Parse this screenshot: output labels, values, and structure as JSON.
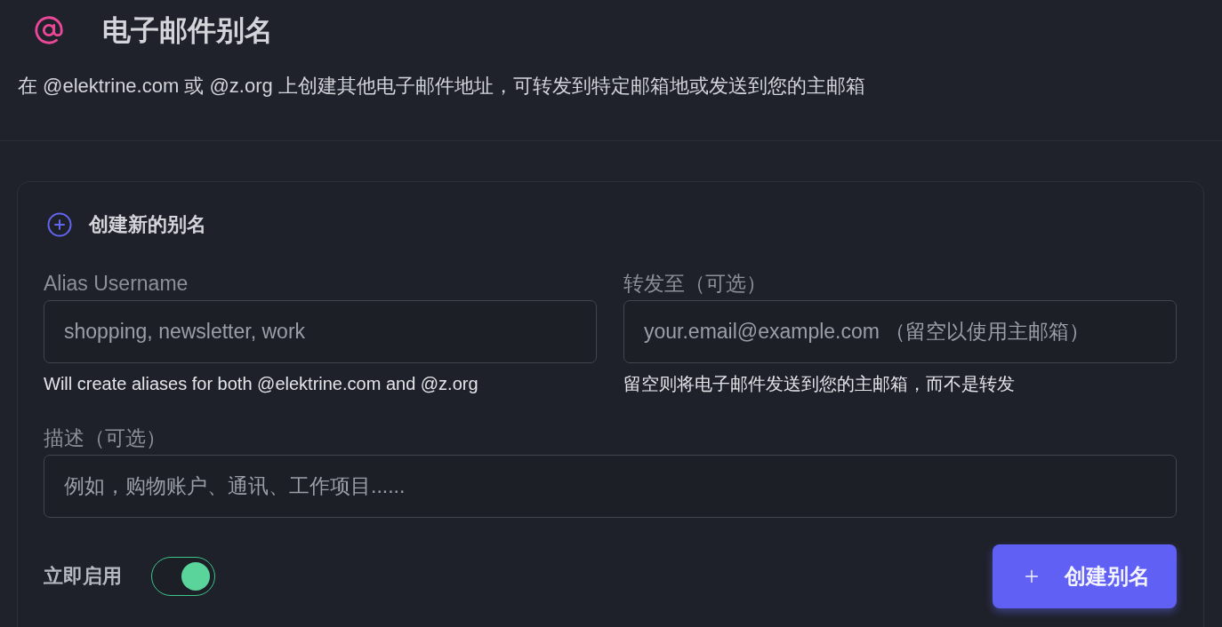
{
  "header": {
    "title": "电子邮件别名",
    "subtitle": "在 @elektrine.com 或 @z.org 上创建其他电子邮件地址，可转发到特定邮箱地或发送到您的主邮箱"
  },
  "form": {
    "heading": "创建新的别名",
    "fields": [
      {
        "label": "Alias Username",
        "placeholder": "shopping, newsletter, work",
        "help": "Will create aliases for both @elektrine.com and @z.org"
      },
      {
        "label": "转发至（可选）",
        "placeholder": "your.email@example.com （留空以使用主邮箱）",
        "help": "留空则将电子邮件发送到您的主邮箱，而不是转发"
      },
      {
        "label": "描述（可选）",
        "placeholder": "例如，购物账户、通讯、工作项目......"
      }
    ],
    "toggle": {
      "label": "立即启用",
      "on": true
    },
    "submit": {
      "label": "创建别名"
    }
  }
}
